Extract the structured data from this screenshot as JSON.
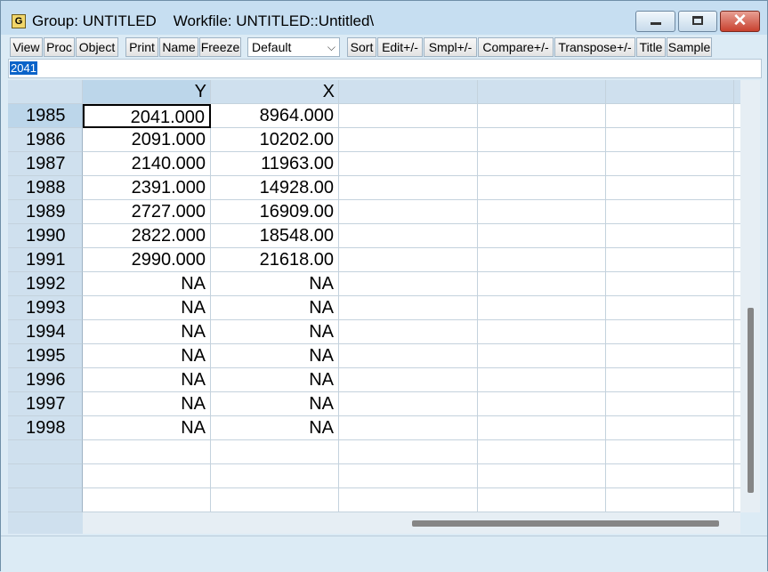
{
  "window": {
    "app_icon": "G",
    "title": "Group: UNTITLED    Workfile: UNTITLED::Untitled\\"
  },
  "toolbar": {
    "view": "View",
    "proc": "Proc",
    "object": "Object",
    "print": "Print",
    "name": "Name",
    "freeze": "Freeze",
    "display_format": "Default",
    "sort": "Sort",
    "edit": "Edit+/-",
    "smpl": "Smpl+/-",
    "compare": "Compare+/-",
    "transpose": "Transpose+/-",
    "title": "Title",
    "sample": "Sample"
  },
  "editbar": {
    "value": "2041"
  },
  "grid": {
    "columns": [
      "Y",
      "X"
    ],
    "rows": [
      {
        "obs": "1985",
        "y": "2041.000",
        "x": "8964.000"
      },
      {
        "obs": "1986",
        "y": "2091.000",
        "x": "10202.00"
      },
      {
        "obs": "1987",
        "y": "2140.000",
        "x": "11963.00"
      },
      {
        "obs": "1988",
        "y": "2391.000",
        "x": "14928.00"
      },
      {
        "obs": "1989",
        "y": "2727.000",
        "x": "16909.00"
      },
      {
        "obs": "1990",
        "y": "2822.000",
        "x": "18548.00"
      },
      {
        "obs": "1991",
        "y": "2990.000",
        "x": "21618.00"
      },
      {
        "obs": "1992",
        "y": "NA",
        "x": "NA"
      },
      {
        "obs": "1993",
        "y": "NA",
        "x": "NA"
      },
      {
        "obs": "1994",
        "y": "NA",
        "x": "NA"
      },
      {
        "obs": "1995",
        "y": "NA",
        "x": "NA"
      },
      {
        "obs": "1996",
        "y": "NA",
        "x": "NA"
      },
      {
        "obs": "1997",
        "y": "NA",
        "x": "NA"
      },
      {
        "obs": "1998",
        "y": "NA",
        "x": "NA"
      }
    ]
  }
}
